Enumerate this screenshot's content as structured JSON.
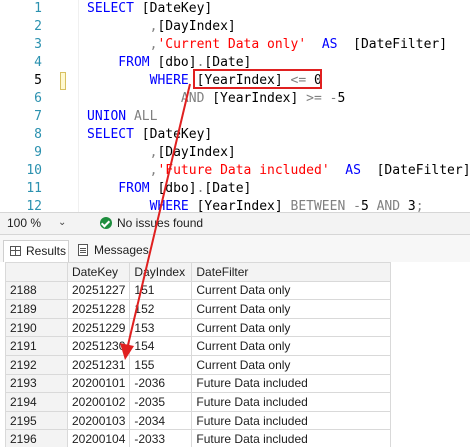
{
  "editor": {
    "lines": [
      {
        "num": "1",
        "parts": [
          {
            "t": "SELECT ",
            "c": "kw"
          },
          {
            "t": "[DateKey]",
            "c": ""
          }
        ]
      },
      {
        "num": "2",
        "parts": [
          {
            "t": "        ,",
            "c": "gray"
          },
          {
            "t": "[DayIndex]",
            "c": ""
          }
        ]
      },
      {
        "num": "3",
        "parts": [
          {
            "t": "        ,",
            "c": "gray"
          },
          {
            "t": "'Current Data only'",
            "c": "str"
          },
          {
            "t": "  AS  ",
            "c": "kw"
          },
          {
            "t": "[DateFilter]",
            "c": ""
          }
        ]
      },
      {
        "num": "4",
        "parts": [
          {
            "t": "    FROM ",
            "c": "kw"
          },
          {
            "t": "[dbo]",
            "c": ""
          },
          {
            "t": ".",
            "c": "gray"
          },
          {
            "t": "[Date]",
            "c": ""
          }
        ]
      },
      {
        "num": "5",
        "parts": [
          {
            "t": "        WHERE ",
            "c": "kw"
          },
          {
            "t": "[YearIndex] ",
            "c": ""
          },
          {
            "t": "<=",
            "c": "gray"
          },
          {
            "t": " 0",
            "c": ""
          }
        ],
        "active": true
      },
      {
        "num": "6",
        "parts": [
          {
            "t": "            AND ",
            "c": "gray"
          },
          {
            "t": "[YearIndex] ",
            "c": ""
          },
          {
            "t": ">=",
            "c": "gray"
          },
          {
            "t": " ",
            "c": ""
          },
          {
            "t": "-",
            "c": "gray"
          },
          {
            "t": "5",
            "c": ""
          }
        ]
      },
      {
        "num": "7",
        "parts": [
          {
            "t": "UNION ",
            "c": "kw"
          },
          {
            "t": "ALL",
            "c": "gray"
          }
        ]
      },
      {
        "num": "8",
        "parts": [
          {
            "t": "SELECT ",
            "c": "kw"
          },
          {
            "t": "[DateKey]",
            "c": ""
          }
        ]
      },
      {
        "num": "9",
        "parts": [
          {
            "t": "        ,",
            "c": "gray"
          },
          {
            "t": "[DayIndex]",
            "c": ""
          }
        ]
      },
      {
        "num": "10",
        "parts": [
          {
            "t": "        ,",
            "c": "gray"
          },
          {
            "t": "'Future Data included'",
            "c": "str"
          },
          {
            "t": "  AS  ",
            "c": "kw"
          },
          {
            "t": "[DateFilter]",
            "c": ""
          }
        ]
      },
      {
        "num": "11",
        "parts": [
          {
            "t": "    FROM ",
            "c": "kw"
          },
          {
            "t": "[dbo]",
            "c": ""
          },
          {
            "t": ".",
            "c": "gray"
          },
          {
            "t": "[Date]",
            "c": ""
          }
        ]
      },
      {
        "num": "12",
        "parts": [
          {
            "t": "        WHERE ",
            "c": "kw"
          },
          {
            "t": "[YearIndex] ",
            "c": ""
          },
          {
            "t": "BETWEEN ",
            "c": "gray"
          },
          {
            "t": "-",
            "c": "gray"
          },
          {
            "t": "5 ",
            "c": ""
          },
          {
            "t": "AND ",
            "c": "gray"
          },
          {
            "t": "3",
            "c": ""
          },
          {
            "t": ";",
            "c": "gray"
          }
        ]
      }
    ]
  },
  "status_bar": {
    "zoom": "100 %",
    "zoom_caret": "⌄",
    "issues": "No issues found"
  },
  "tabs": {
    "results": "Results",
    "messages": "Messages"
  },
  "grid": {
    "columns": [
      "DateKey",
      "DayIndex",
      "DateFilter"
    ],
    "rows": [
      {
        "num": "2188",
        "datekey": "20251227",
        "dayindex": "151",
        "datefilter": "Current Data only"
      },
      {
        "num": "2189",
        "datekey": "20251228",
        "dayindex": "152",
        "datefilter": "Current Data only"
      },
      {
        "num": "2190",
        "datekey": "20251229",
        "dayindex": "153",
        "datefilter": "Current Data only"
      },
      {
        "num": "2191",
        "datekey": "20251230",
        "dayindex": "154",
        "datefilter": "Current Data only"
      },
      {
        "num": "2192",
        "datekey": "20251231",
        "dayindex": "155",
        "datefilter": "Current Data only"
      },
      {
        "num": "2193",
        "datekey": "20200101",
        "dayindex": "-2036",
        "datefilter": "Future Data included"
      },
      {
        "num": "2194",
        "datekey": "20200102",
        "dayindex": "-2035",
        "datefilter": "Future Data included"
      },
      {
        "num": "2195",
        "datekey": "20200103",
        "dayindex": "-2034",
        "datefilter": "Future Data included"
      },
      {
        "num": "2196",
        "datekey": "20200104",
        "dayindex": "-2033",
        "datefilter": "Future Data included"
      }
    ]
  },
  "colors": {
    "keyword": "#0000ff",
    "string": "#ff0000",
    "operator": "#808080",
    "line_number": "#2b91af",
    "annotation": "#e02020",
    "ok": "#1e8e3e"
  }
}
